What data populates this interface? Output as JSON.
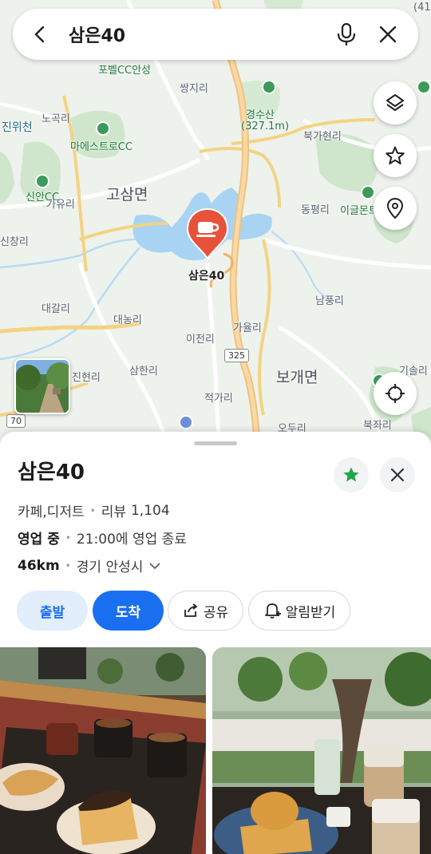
{
  "search": {
    "query": "삼은40"
  },
  "map": {
    "pin_label": "삼은40",
    "route_number": "325",
    "route_number_2": "70",
    "labels": {
      "ssangji": "쌍지리",
      "gyeongsusan": "경수산",
      "gyeongsusan_height": "(327.1m)",
      "pobel_cc": "포벨CC안성",
      "nogokri": "노곡리",
      "jinwicheon": "진위천",
      "maestro_cc": "마에스트로CC",
      "bukgahyeon": "북가현리",
      "gosam": "고삼면",
      "sinan_cc": "신안CC",
      "gayuri": "가유리",
      "dongpyeong": "동평리",
      "eagle_mt": "이글몬트",
      "sinchang": "신창리",
      "daegal": "대갈리",
      "daenong": "대농리",
      "nampung": "남풍리",
      "ijeon": "이전리",
      "gayul": "가율리",
      "jinhyeon": "진현리",
      "samhan": "삼한리",
      "bogae": "보개면",
      "gisol": "기솔리",
      "jeokga": "적가리",
      "odu": "오두리",
      "bukjwa": "북좌리",
      "top_right": "(41"
    }
  },
  "place": {
    "name": "삼은40",
    "category": "카페,디저트",
    "review_label": "리뷰",
    "review_count": "1,104",
    "status": "영업 중",
    "hours": "21:00에 영업 종료",
    "distance": "46km",
    "region": "경기 안성시"
  },
  "actions": {
    "depart": "출발",
    "arrive": "도착",
    "share": "공유",
    "notify": "알림받기"
  },
  "colors": {
    "accent": "#1a6ff0",
    "pin": "#e8513a",
    "saved_star": "#1fa64a",
    "water": "#a9d3f2"
  }
}
